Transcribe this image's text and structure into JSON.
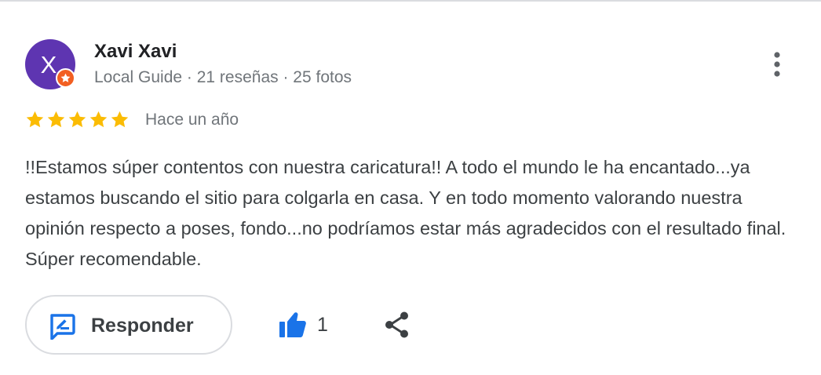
{
  "review": {
    "author": {
      "avatar_letter": "X",
      "avatar_color": "#5e35b1",
      "name": "Xavi Xavi",
      "meta": "Local Guide · 21 reseñas · 25 fotos",
      "badge_icon": "local-guide-star-badge",
      "badge_color": "#f25f22"
    },
    "rating": {
      "stars": 5,
      "max": 5,
      "star_color": "#fbbc04"
    },
    "date": "Hace un año",
    "text": "!!Estamos súper contentos con nuestra caricatura!! A todo el mundo le ha encantado...ya estamos buscando el sitio para colgarla en casa. Y en todo momento valorando nuestra opinión respecto a poses, fondo...no podríamos estar más agradecidos con el resultado final. Súper recomendable.",
    "actions": {
      "reply_label": "Responder",
      "reply_icon": "rate-review-icon",
      "like_icon": "thumbs-up-icon",
      "like_count": "1",
      "share_icon": "share-icon",
      "more_icon": "more-vert-icon",
      "accent_color": "#1a73e8"
    }
  }
}
